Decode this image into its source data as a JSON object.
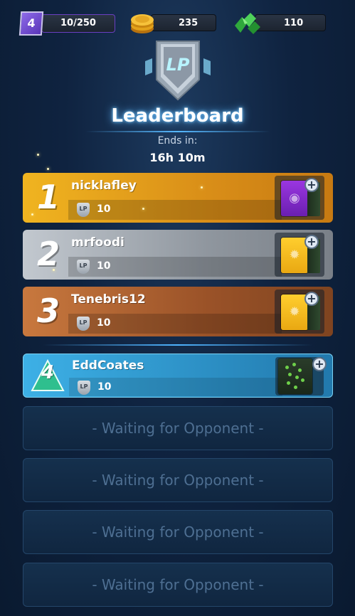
{
  "header": {
    "level": "4",
    "xp": "10/250",
    "coins": "235",
    "gems": "110"
  },
  "emblem": {
    "text": "LP"
  },
  "title": "Leaderboard",
  "ends_label": "Ends in:",
  "ends_time": "16h 10m",
  "lp_icon_text": "LP",
  "players": [
    {
      "rank": "1",
      "name": "nicklafley",
      "lp": "10",
      "tier": "gold",
      "chest_color": "#9a36e0"
    },
    {
      "rank": "2",
      "name": "mrfoodi",
      "lp": "10",
      "tier": "silver",
      "chest_color": "#ffce2e"
    },
    {
      "rank": "3",
      "name": "Tenebris12",
      "lp": "10",
      "tier": "bronze",
      "chest_color": "#ffce2e"
    },
    {
      "rank": "4",
      "name": "EddCoates",
      "lp": "10",
      "tier": "self",
      "chest_color": "#1d2d1d"
    }
  ],
  "waiting_slots": [
    "- Waiting for Opponent -",
    "- Waiting for Opponent -",
    "- Waiting for Opponent -",
    "- Waiting for Opponent -"
  ],
  "plus_label": "+",
  "colors": {
    "background": "#0f2340",
    "gold_row": "#f0b420",
    "silver_row": "#c2c8cf",
    "bronze_row": "#c8783e",
    "self_row": "#3db0e6",
    "title_glow": "#5fb6ff"
  },
  "icons": {
    "level": "level-badge-icon",
    "coins": "coin-stack-icon",
    "gems": "green-gem-icon",
    "emblem": "lp-shield-icon",
    "add": "plus-icon"
  }
}
